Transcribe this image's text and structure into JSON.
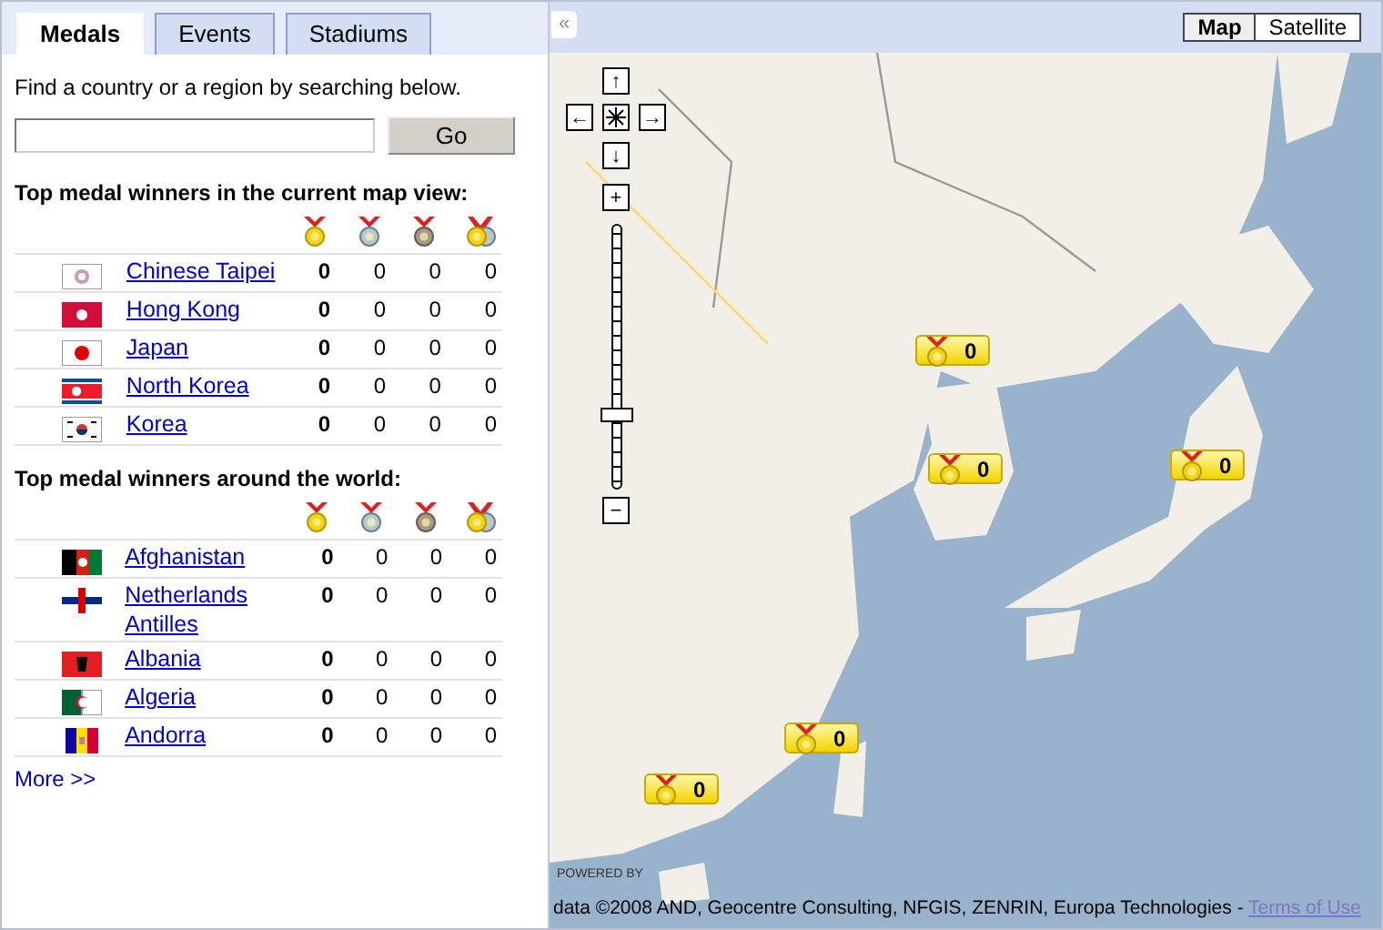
{
  "tabs": [
    {
      "label": "Medals",
      "selected": true
    },
    {
      "label": "Events",
      "selected": false
    },
    {
      "label": "Stadiums",
      "selected": false
    }
  ],
  "search": {
    "prompt": "Find a country or a region by searching below.",
    "button": "Go"
  },
  "sections": [
    {
      "title": "Top medal winners in the current map view:",
      "rows": [
        {
          "country": "Chinese Taipei",
          "gold": "0",
          "silver": "0",
          "bronze": "0",
          "total": "0"
        },
        {
          "country": "Hong Kong",
          "gold": "0",
          "silver": "0",
          "bronze": "0",
          "total": "0"
        },
        {
          "country": "Japan",
          "gold": "0",
          "silver": "0",
          "bronze": "0",
          "total": "0"
        },
        {
          "country": "North Korea",
          "gold": "0",
          "silver": "0",
          "bronze": "0",
          "total": "0"
        },
        {
          "country": "Korea",
          "gold": "0",
          "silver": "0",
          "bronze": "0",
          "total": "0"
        }
      ]
    },
    {
      "title": "Top medal winners around the world:",
      "rows": [
        {
          "country": "Afghanistan",
          "gold": "0",
          "silver": "0",
          "bronze": "0",
          "total": "0"
        },
        {
          "country": "Netherlands Antilles",
          "gold": "0",
          "silver": "0",
          "bronze": "0",
          "total": "0"
        },
        {
          "country": "Albania",
          "gold": "0",
          "silver": "0",
          "bronze": "0",
          "total": "0"
        },
        {
          "country": "Algeria",
          "gold": "0",
          "silver": "0",
          "bronze": "0",
          "total": "0"
        },
        {
          "country": "Andorra",
          "gold": "0",
          "silver": "0",
          "bronze": "0",
          "total": "0"
        }
      ]
    }
  ],
  "more_link": "More >>",
  "map": {
    "collapse": "«",
    "map_types": [
      {
        "label": "Map",
        "selected": true
      },
      {
        "label": "Satellite",
        "selected": false
      }
    ],
    "pan": {
      "up": "↑",
      "left": "←",
      "right": "→",
      "down": "↓"
    },
    "zoom_in": "+",
    "zoom_out": "−",
    "zoom": {
      "level": 0.26
    },
    "markers": [
      {
        "count": "0"
      },
      {
        "count": "0"
      },
      {
        "count": "0"
      },
      {
        "count": "0"
      },
      {
        "count": "0"
      }
    ],
    "powered_by": "POWERED BY",
    "attribution": "data ©2008 AND, Geocentre Consulting, NFGIS, ZENRIN, Europa Technologies - ",
    "terms_link": "Terms of Use"
  }
}
